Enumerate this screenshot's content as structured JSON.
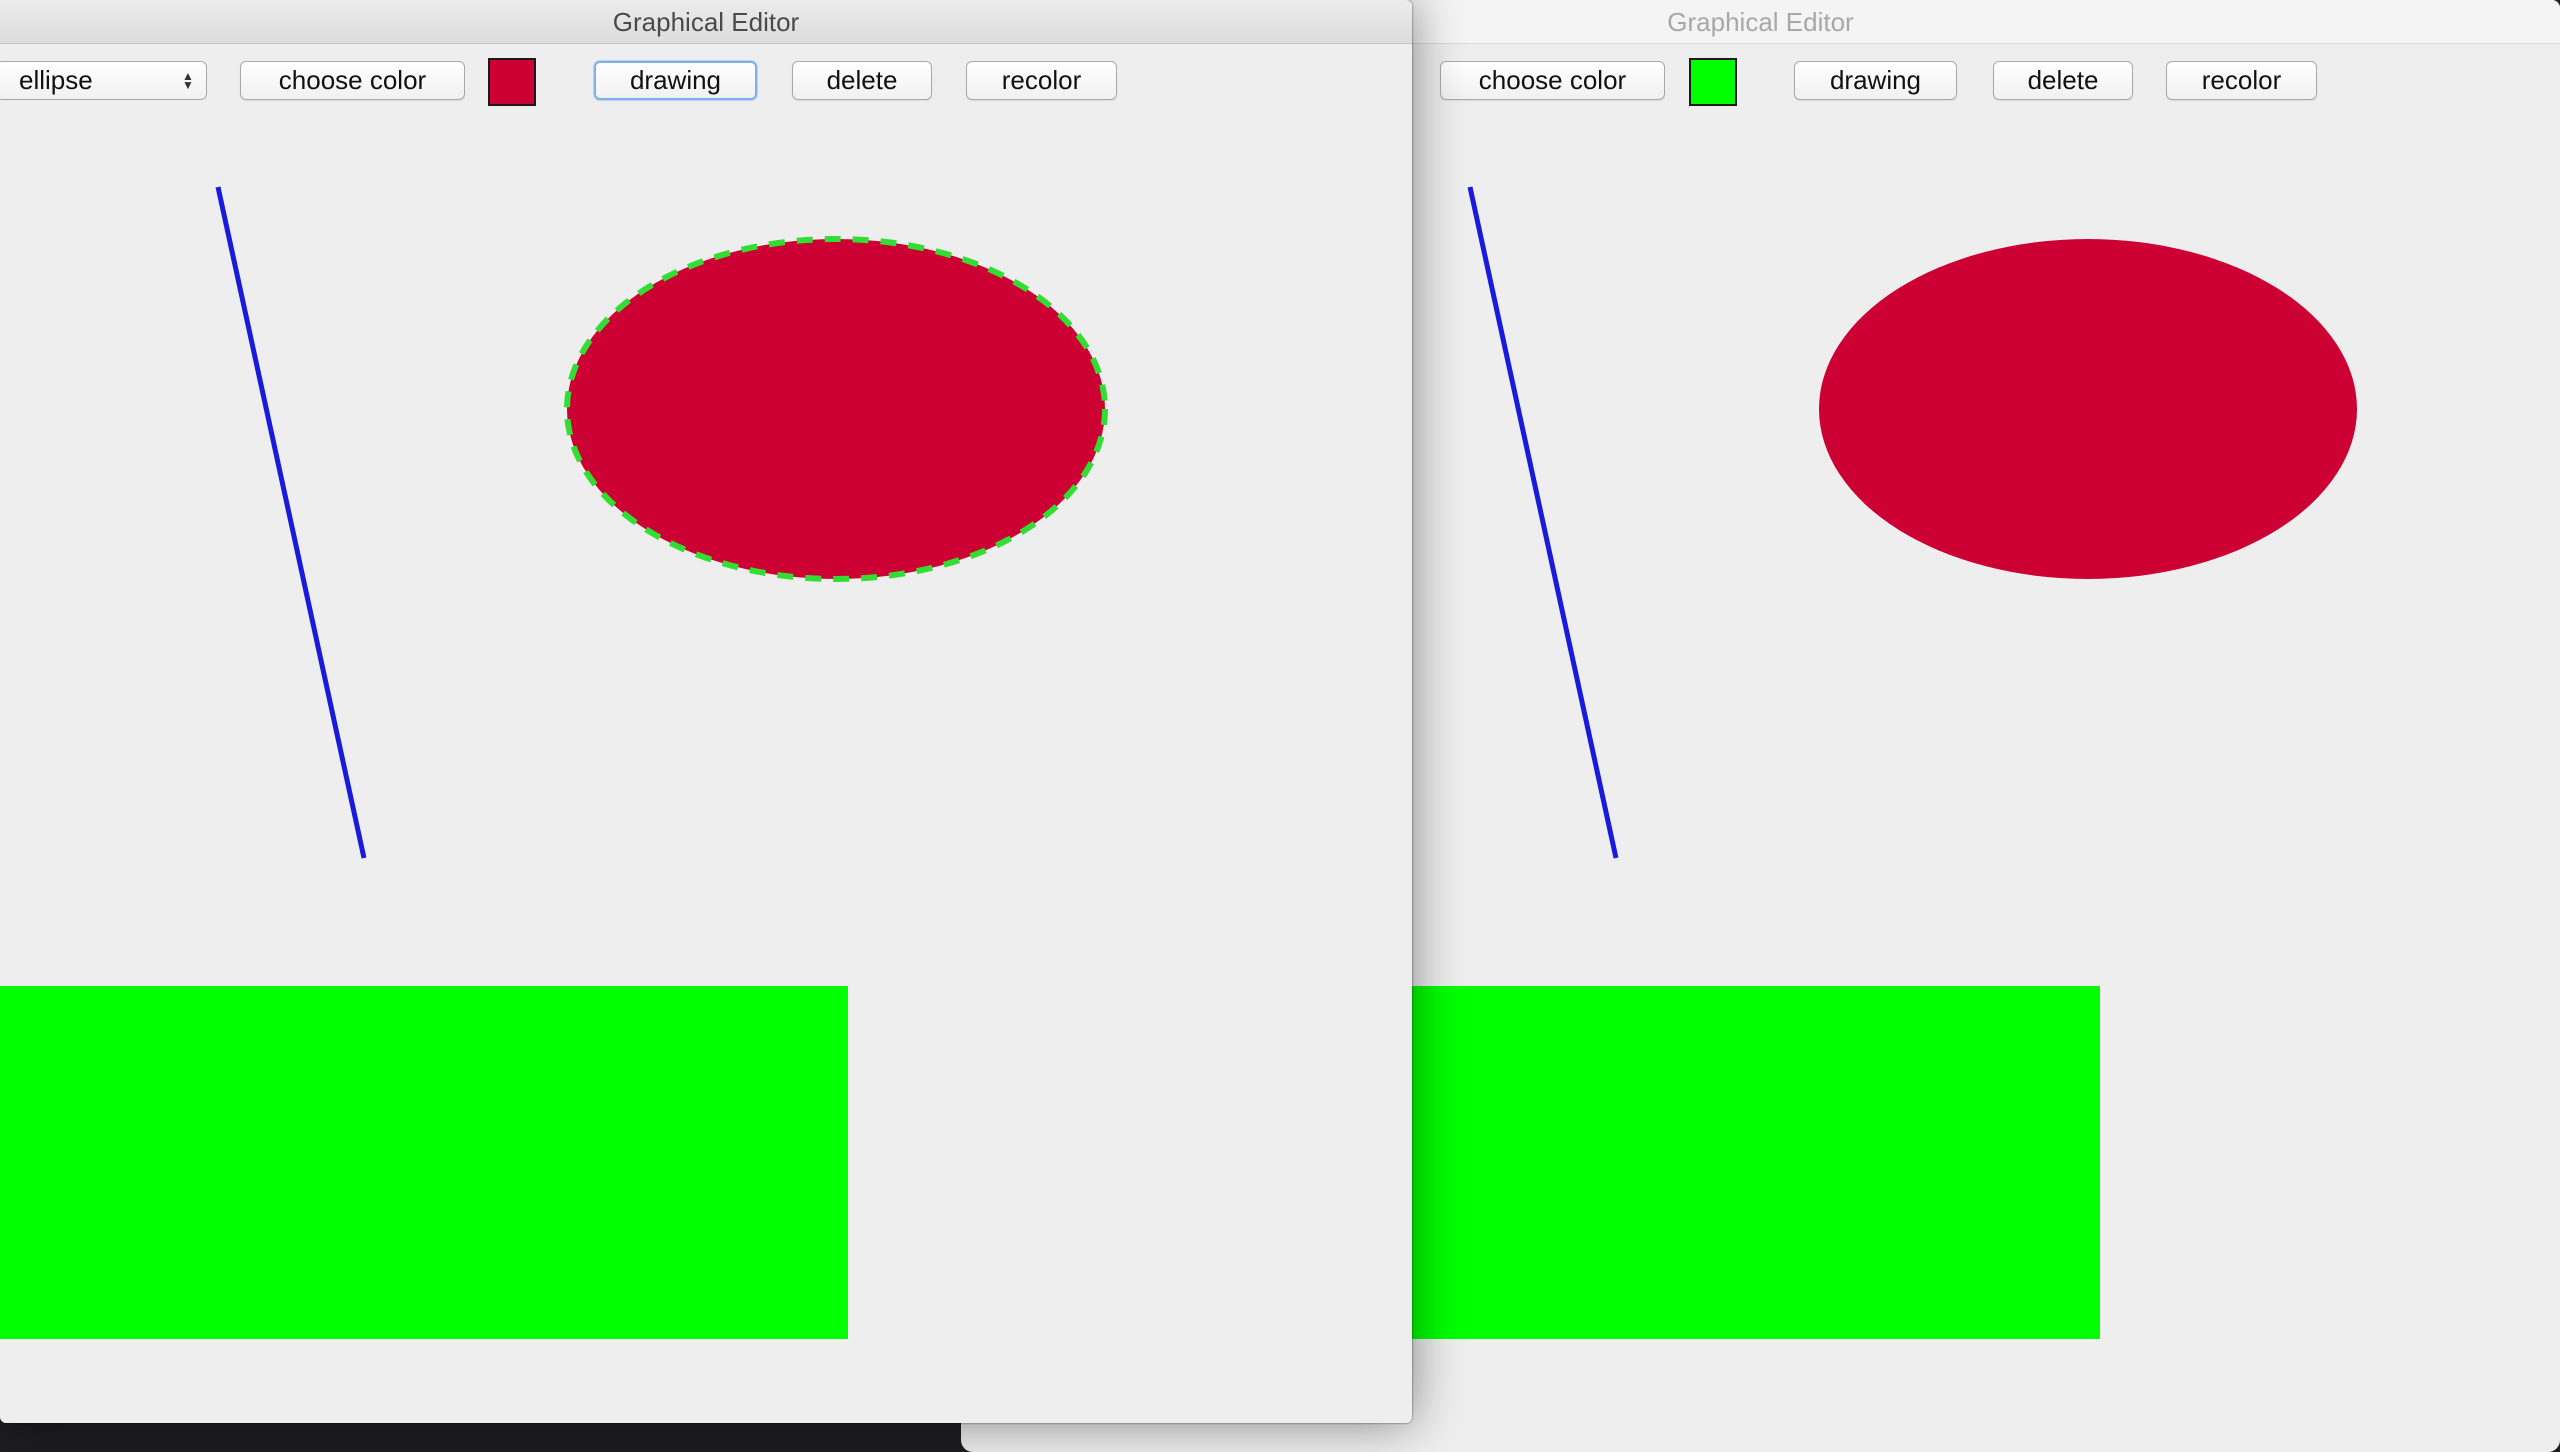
{
  "windows": [
    {
      "id": "back",
      "title": "Graphical Editor",
      "active": false,
      "toolbar": {
        "choose_color": "choose color",
        "current_color": "#00ff00",
        "drawing": "drawing",
        "delete": "delete",
        "recolor": "recolor"
      }
    },
    {
      "id": "front",
      "title": "Graphical Editor",
      "active": true,
      "toolbar": {
        "shape_select": "ellipse",
        "choose_color": "choose color",
        "current_color": "#cc0033",
        "drawing": "drawing",
        "delete": "delete",
        "recolor": "recolor"
      }
    }
  ],
  "colors": {
    "line": "#1a1adc",
    "ellipse_fill": "#cc0033",
    "rect_fill": "#00ff00",
    "selection_outline": "#33dd33"
  }
}
